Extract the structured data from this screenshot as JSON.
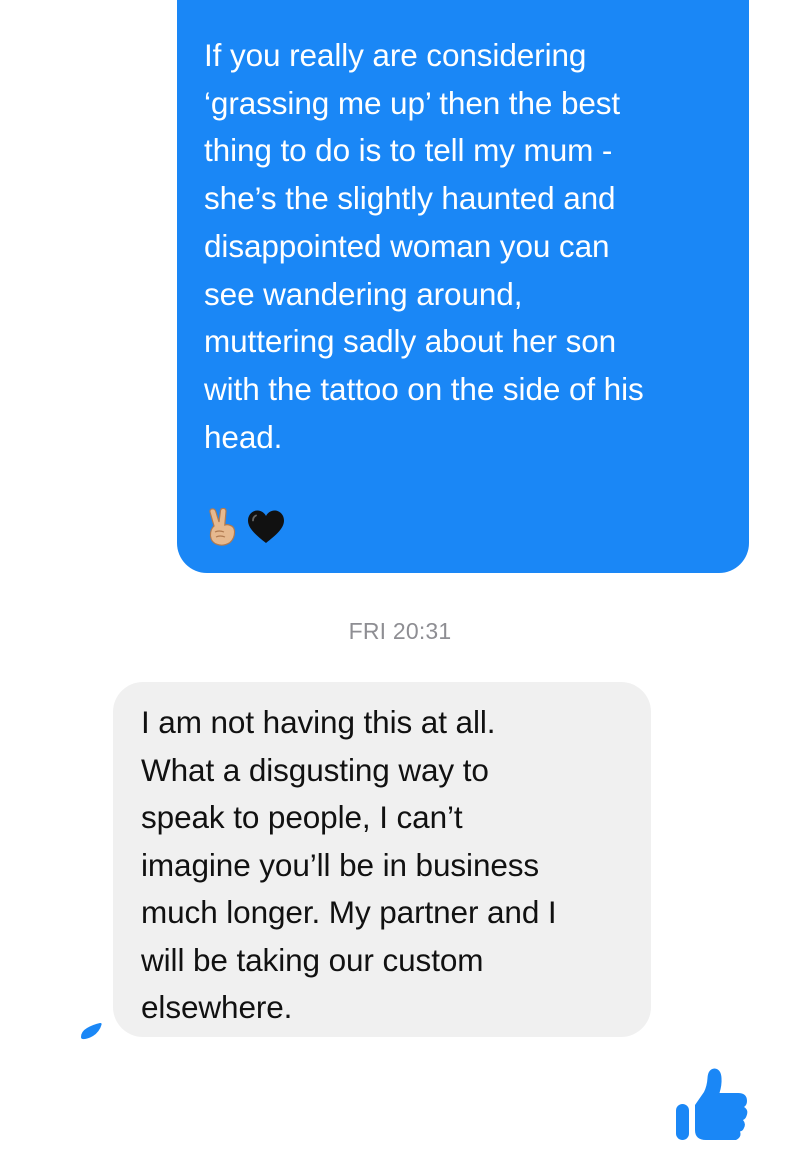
{
  "conversation": {
    "outgoing_message": {
      "text": "If you really are considering\n‘grassing me up’ then the best\nthing to do is to tell my mum -\nshe’s the slightly haunted and\ndisappointed woman you can\nsee wandering around,\nmuttering sadly about her son\nwith the tattoo on the side of his\nhead.",
      "emoji_icons": [
        "victory-hand-icon",
        "black-heart-icon"
      ],
      "bubble_color": "#1a87f6"
    },
    "timestamp": "FRI 20:31",
    "incoming_message": {
      "text": "I am not having this at all.\nWhat a disgusting way to\nspeak to people, I can’t\nimagine you’ll be in business\nmuch longer. My partner and I\nwill be taking our custom\nelsewhere.",
      "bubble_color": "#f0f0f0"
    },
    "read_receipt_icon": "seen-indicator-icon",
    "like_icon": "thumbs-up-icon",
    "accent_color": "#1a87f6"
  }
}
